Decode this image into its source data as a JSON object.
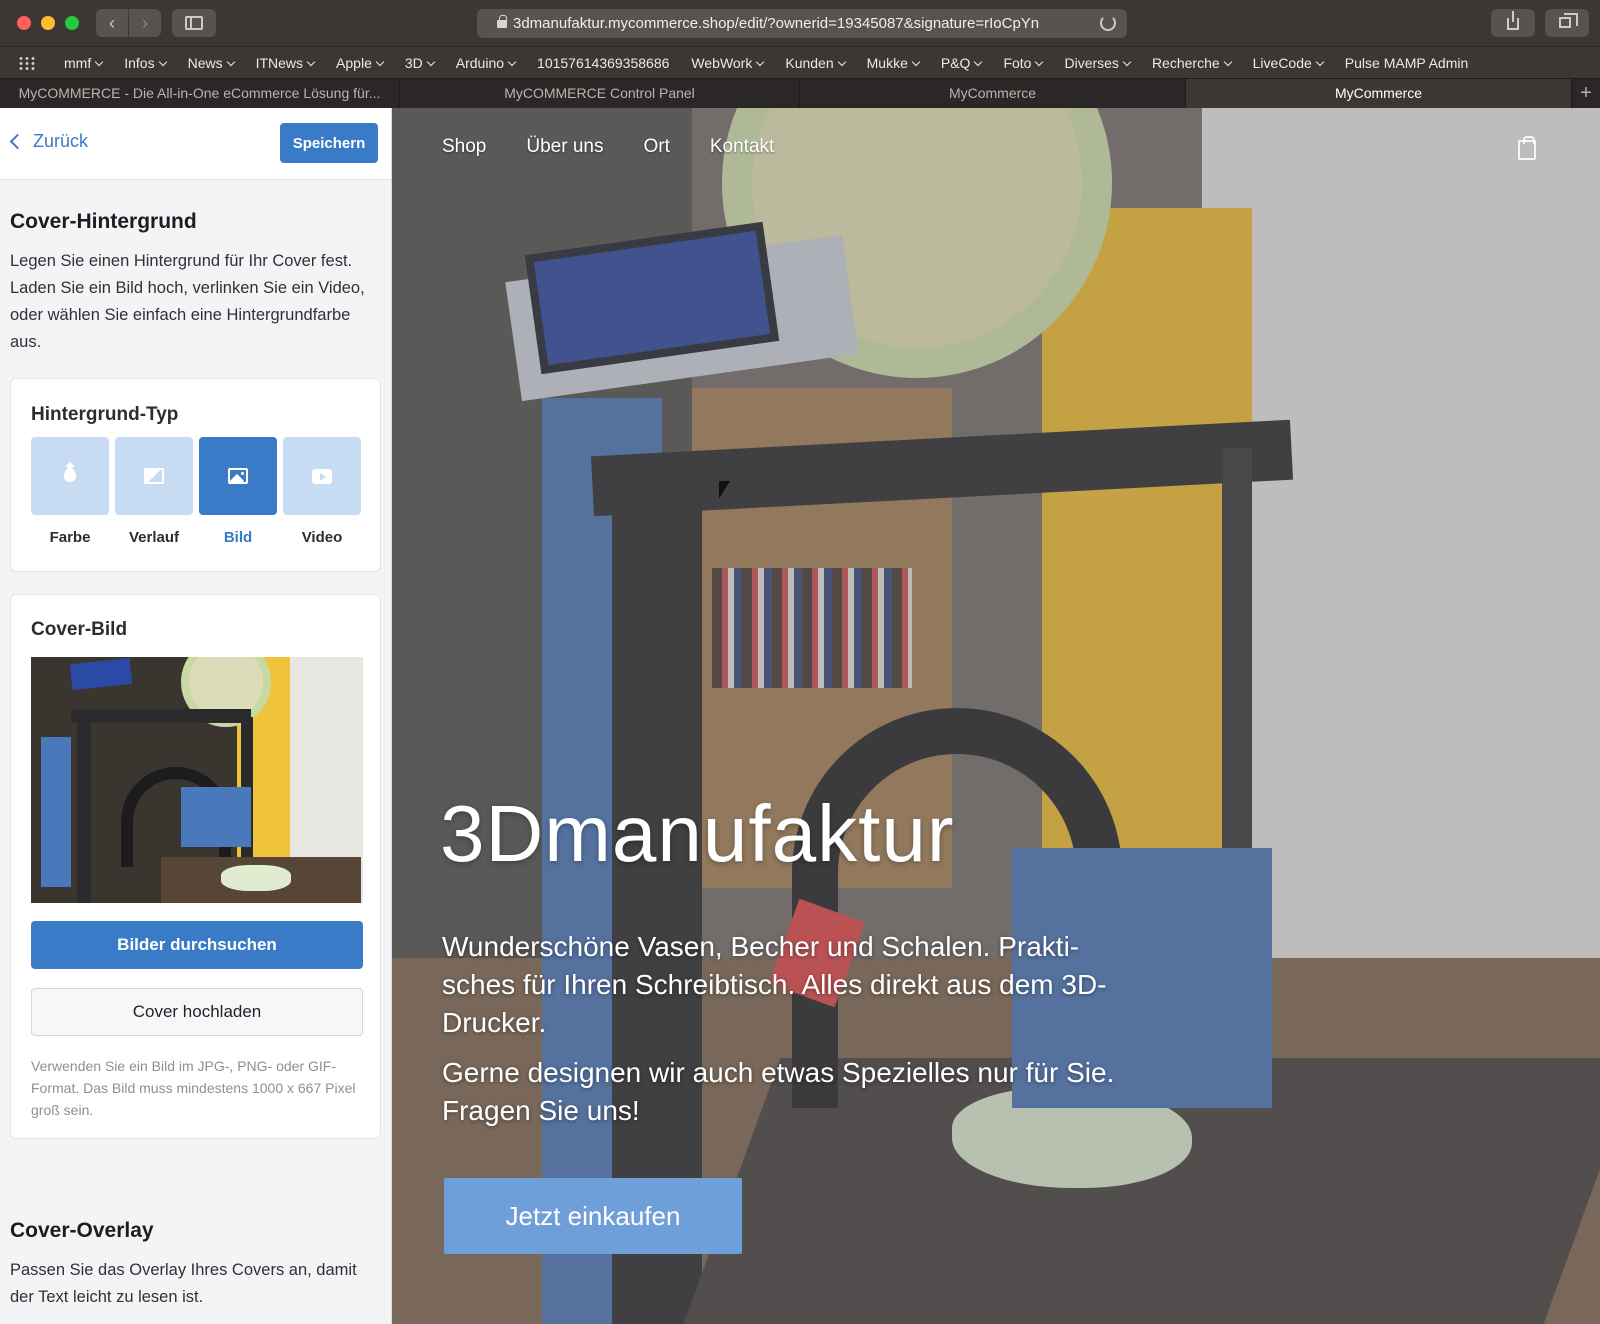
{
  "browser": {
    "url": "3dmanufaktur.mycommerce.shop/edit/?ownerid=19345087&signature=rIoCpYn",
    "bookmarks": [
      "mmf",
      "Infos",
      "News",
      "ITNews",
      "Apple",
      "3D",
      "Arduino",
      "10157614369358686",
      "WebWork",
      "Kunden",
      "Mukke",
      "P&Q",
      "Foto",
      "Diverses",
      "Recherche",
      "LiveCode",
      "Pulse MAMP Admin"
    ],
    "tabs": [
      {
        "label": "MyCOMMERCE - Die All-in-One eCommerce Lösung für..."
      },
      {
        "label": "MyCOMMERCE Control Panel"
      },
      {
        "label": "MyCommerce"
      },
      {
        "label": "MyCommerce",
        "active": true
      }
    ],
    "new_tab": "+"
  },
  "panel": {
    "back_label": "Zurück",
    "save_label": "Speichern",
    "cover_bg": {
      "title": "Cover-Hintergrund",
      "description": "Legen Sie einen Hintergrund für Ihr Cover fest. Laden Sie ein Bild hoch, verlinken Sie ein Video, oder wählen Sie einfach eine Hintergrundfarbe aus."
    },
    "bg_type": {
      "title": "Hintergrund-Typ",
      "options": [
        {
          "label": "Farbe",
          "icon": "drop-icon"
        },
        {
          "label": "Verlauf",
          "icon": "gradient-icon"
        },
        {
          "label": "Bild",
          "icon": "image-icon",
          "selected": true
        },
        {
          "label": "Video",
          "icon": "video-icon"
        }
      ]
    },
    "cover_image": {
      "title": "Cover-Bild",
      "browse_label": "Bilder durchsuchen",
      "upload_label": "Cover hochladen",
      "hint": "Verwenden Sie ein Bild im JPG-, PNG- oder GIF-Format. Das Bild muss mindestens 1000 x 667 Pixel groß sein."
    },
    "overlay": {
      "title": "Cover-Overlay",
      "description": "Passen Sie das Overlay Ihres Covers an, damit der Text leicht zu lesen ist."
    }
  },
  "preview": {
    "nav": [
      "Shop",
      "Über uns",
      "Ort",
      "Kontakt"
    ],
    "hero_title": "3Dmanufaktur",
    "hero_text_1": "Wunderschöne Vasen, Becher und Schalen. Prakti-sches für Ihren Schreibtisch. Alles direkt aus dem 3D-Drucker.",
    "hero_text_2": "Gerne designen wir auch etwas Spezielles nur für Sie. Fragen Sie uns!",
    "cta_label": "Jetzt einkaufen"
  },
  "colors": {
    "accent": "#3a7bc8",
    "tile_inactive": "#c7dcf3",
    "cta": "#6f9fd8"
  }
}
